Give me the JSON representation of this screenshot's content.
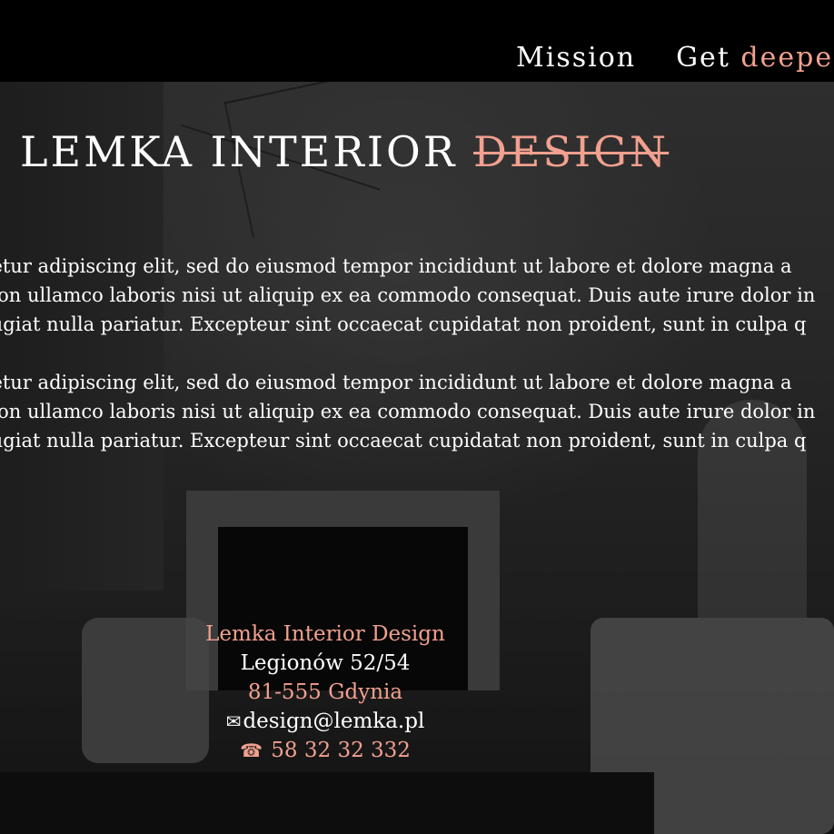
{
  "nav": {
    "items": [
      {
        "label": "Mission"
      },
      {
        "prefix": "Get",
        "accent": "deeper"
      }
    ]
  },
  "title": {
    "main": "LEMKA INTERIOR",
    "struck": "DESIGN"
  },
  "paragraphs": [
    [
      "tetur adipiscing elit, sed do eiusmod tempor incididunt ut labore et dolore magna a",
      "tion ullamco laboris nisi ut aliquip ex ea commodo consequat. Duis aute irure dolor in",
      "fugiat nulla pariatur. Excepteur sint occaecat cupidatat non proident, sunt in culpa q"
    ],
    [
      "tetur adipiscing elit, sed do eiusmod tempor incididunt ut labore et dolore magna a",
      "tion ullamco laboris nisi ut aliquip ex ea commodo consequat. Duis aute irure dolor in",
      "fugiat nulla pariatur. Excepteur sint occaecat cupidatat non proident, sunt in culpa q"
    ]
  ],
  "contact": {
    "company": "Lemka Interior Design",
    "street": "Legionów 52/54",
    "city": "81-555 Gdynia",
    "email": "design@lemka.pl",
    "phone": "58 32 32 332",
    "email_icon": "envelope-icon",
    "phone_icon": "phone-icon"
  },
  "colors": {
    "accent": "#f2a08f",
    "topbar": "#000000",
    "text": "#ffffff"
  }
}
